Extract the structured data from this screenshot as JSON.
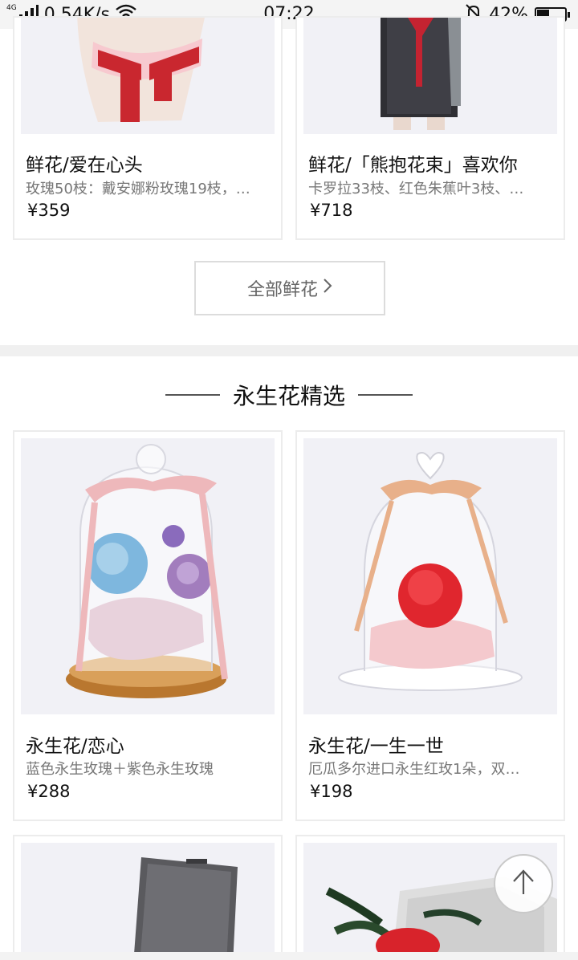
{
  "status_bar": {
    "network": "4G",
    "speed": "0.54K/s",
    "time": "07:22",
    "battery": "42%",
    "battery_level": 0.42
  },
  "fresh_flowers": {
    "products": [
      {
        "name": "鲜花/爱在心头",
        "desc": "玫瑰50枝：戴安娜粉玫瑰19枝，…",
        "price": "¥359"
      },
      {
        "name": "鲜花/「熊抱花束」喜欢你",
        "desc": "卡罗拉33枝、红色朱蕉叶3枝、…",
        "price": "¥718"
      }
    ],
    "more_button": "全部鲜花"
  },
  "preserved_flowers": {
    "section_title": "永生花精选",
    "products": [
      {
        "name": "永生花/恋心",
        "desc": "蓝色永生玫瑰＋紫色永生玫瑰",
        "price": "¥288"
      },
      {
        "name": "永生花/一生一世",
        "desc": "厄瓜多尔进口永生红玫1朵，双…",
        "price": "¥198"
      }
    ]
  },
  "icons": {
    "scroll_top": "arrow-up-icon"
  },
  "colors": {
    "background": "#ffffff",
    "image_bg": "#f1f1f6",
    "divider_band": "#f0f0f0"
  }
}
